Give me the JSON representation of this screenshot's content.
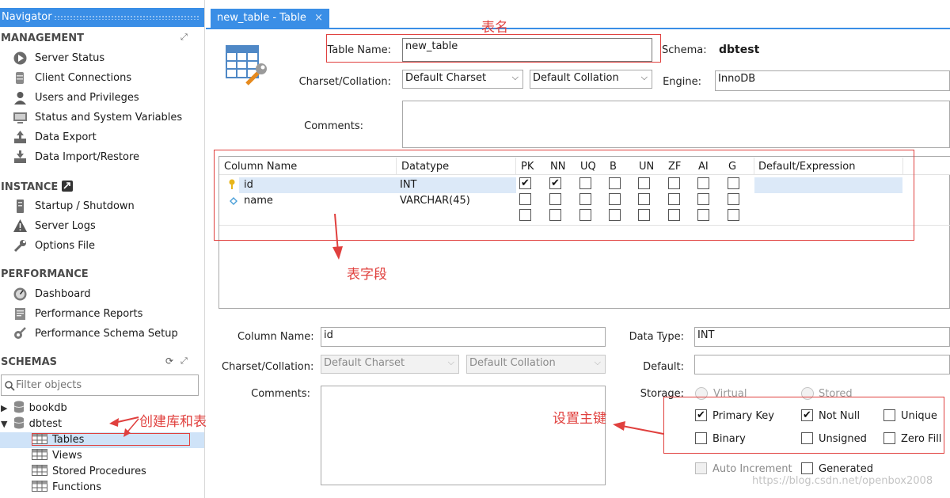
{
  "navigator": {
    "title": "Navigator",
    "management": {
      "heading": "MANAGEMENT",
      "items": [
        "Server Status",
        "Client Connections",
        "Users and Privileges",
        "Status and System Variables",
        "Data Export",
        "Data Import/Restore"
      ]
    },
    "instance": {
      "heading": "INSTANCE",
      "items": [
        "Startup / Shutdown",
        "Server Logs",
        "Options File"
      ]
    },
    "performance": {
      "heading": "PERFORMANCE",
      "items": [
        "Dashboard",
        "Performance Reports",
        "Performance Schema Setup"
      ]
    },
    "schemas": {
      "heading": "SCHEMAS",
      "filter_placeholder": "Filter objects",
      "databases": [
        "bookdb",
        "dbtest"
      ],
      "children": [
        "Tables",
        "Views",
        "Stored Procedures",
        "Functions"
      ]
    }
  },
  "editor": {
    "tab_label": "new_table - Table",
    "tab_close": "×",
    "table_name_label": "Table Name:",
    "table_name_value": "new_table",
    "schema_label": "Schema:",
    "schema_value": "dbtest",
    "charset_label": "Charset/Collation:",
    "charset_value": "Default Charset",
    "collation_value": "Default Collation",
    "engine_label": "Engine:",
    "engine_value": "InnoDB",
    "comments_label": "Comments:",
    "grid": {
      "headers": [
        "Column Name",
        "Datatype",
        "PK",
        "NN",
        "UQ",
        "B",
        "UN",
        "ZF",
        "AI",
        "G",
        "Default/Expression"
      ],
      "rows": [
        {
          "name": "id",
          "type": "INT",
          "flags": [
            true,
            true,
            false,
            false,
            false,
            false,
            false,
            false
          ]
        },
        {
          "name": "name",
          "type": "VARCHAR(45)",
          "flags": [
            false,
            false,
            false,
            false,
            false,
            false,
            false,
            false
          ]
        },
        {
          "name": "",
          "type": "",
          "flags": [
            false,
            false,
            false,
            false,
            false,
            false,
            false,
            false
          ]
        }
      ]
    },
    "detail": {
      "column_name_label": "Column Name:",
      "column_name_value": "id",
      "data_type_label": "Data Type:",
      "data_type_value": "INT",
      "charset_label": "Charset/Collation:",
      "charset_value": "Default Charset",
      "collation_value": "Default Collation",
      "default_label": "Default:",
      "comments_label": "Comments:",
      "storage_label": "Storage:",
      "storage_options": [
        "Virtual",
        "Stored"
      ],
      "checkboxes": {
        "primary_key": "Primary Key",
        "not_null": "Not Null",
        "unique": "Unique",
        "binary": "Binary",
        "unsigned": "Unsigned",
        "zero_fill": "Zero Fill",
        "auto_increment": "Auto Increment",
        "generated": "Generated"
      }
    }
  },
  "annotations": {
    "table_name": "表名",
    "table_fields": "表字段",
    "create_db_table": "创建库和表",
    "set_primary_key": "设置主键",
    "color": "#e0403e"
  },
  "watermark": "https://blog.csdn.net/openbox2008"
}
